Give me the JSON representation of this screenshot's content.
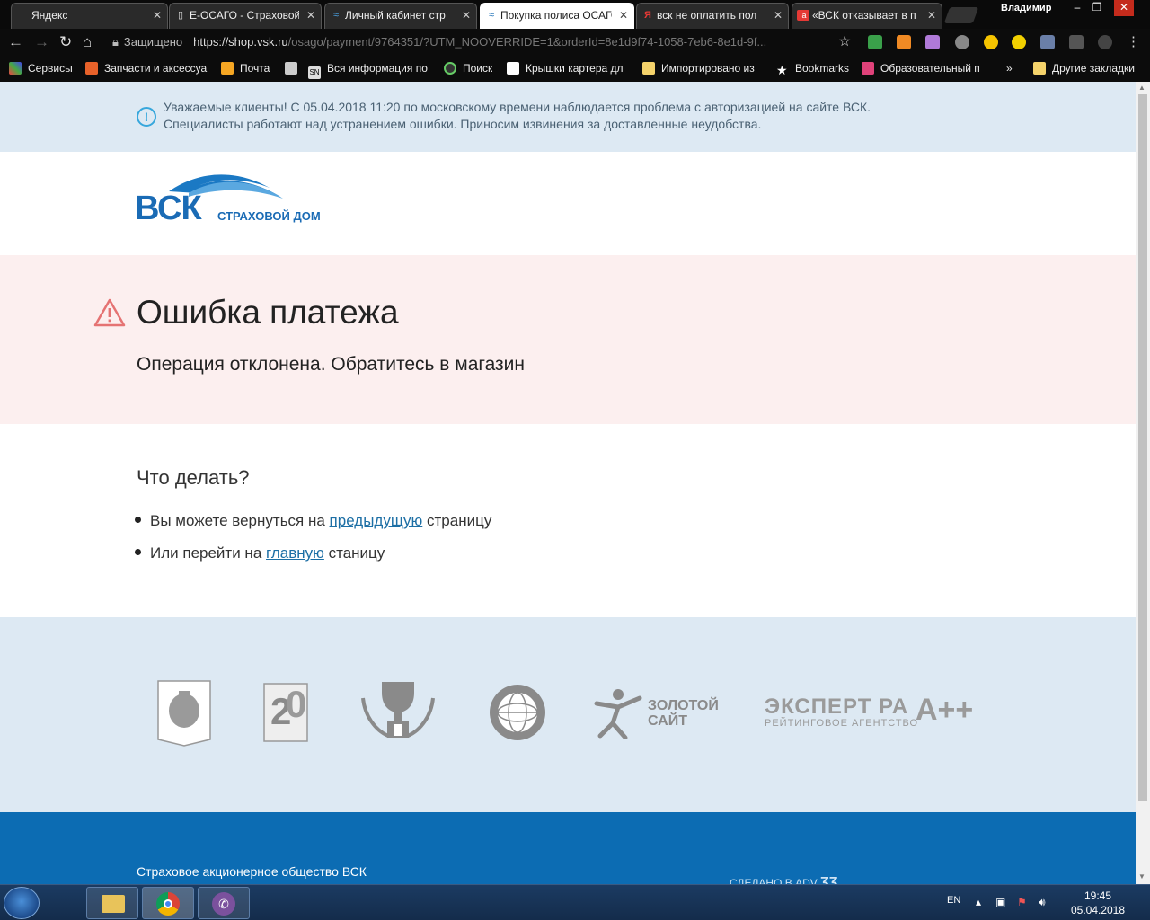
{
  "browser": {
    "tabs": [
      {
        "title": "Яндекс",
        "icon": "yandex-icon",
        "active": false
      },
      {
        "title": "Е-ОСАГО - Страховой",
        "icon": "page-icon",
        "active": false
      },
      {
        "title": "Личный кабинет стр",
        "icon": "vsk-icon",
        "active": false
      },
      {
        "title": "Покупка полиса ОСАГО",
        "icon": "vsk-icon",
        "active": true
      },
      {
        "title": "вск не оплатить пол",
        "icon": "yandex-icon",
        "active": false
      },
      {
        "title": "«ВСК отказывает в п",
        "icon": "la-icon",
        "active": false
      }
    ],
    "user_name": "Владимир",
    "security_label": "Защищено",
    "url_host": "https://shop.vsk.ru",
    "url_path": "/osago/payment/9764351/?UTM_NOOVERRIDE=1&orderId=8e1d9f74-1058-7eb6-8e1d-9f...",
    "bookmarks": [
      {
        "label": "Сервисы",
        "icon": "apps-icon"
      },
      {
        "label": "Запчасти и аксессуа",
        "icon": "parts-icon"
      },
      {
        "label": "Почта",
        "icon": "mail-icon"
      },
      {
        "label": "",
        "icon": "computer-icon"
      },
      {
        "label": "Вся информация по",
        "icon": "sn-icon"
      },
      {
        "label": "Поиск",
        "icon": "search-circle-icon"
      },
      {
        "label": "Крышки картера дл",
        "icon": "parts-icon"
      },
      {
        "label": "Импортировано из",
        "icon": "folder-icon"
      },
      {
        "label": "Bookmarks",
        "icon": "star-icon"
      },
      {
        "label": "Образовательный п",
        "icon": "edu-icon"
      }
    ],
    "bookmarks_overflow": "»",
    "other_bookmarks": "Другие закладки"
  },
  "page": {
    "notice_line1": "Уважаемые клиенты! С 05.04.2018 11:20 по московскому времени наблюдается проблема с авторизацией на сайте ВСК.",
    "notice_line2": "Специалисты работают над устранением ошибки. Приносим извинения за доставленные неудобства.",
    "logo_main": "ВСК",
    "logo_sub": "СТРАХОВОЙ ДОМ",
    "error_title": "Ошибка платежа",
    "error_message": "Операция отклонена. Обратитесь в магазин",
    "what_to_do": "Что делать?",
    "option1_before": "Вы можете вернуться на ",
    "option1_link": "предыдущую",
    "option1_after": " страницу",
    "option2_before": "Или перейти на ",
    "option2_link": "главную",
    "option2_after": " станицу",
    "badge_zoloto_line1": "ЗОЛОТОЙ",
    "badge_zoloto_line2": "САЙТ",
    "badge_expert_line1": "ЭКСПЕРТ РА",
    "badge_expert_line2": "РЕЙТИНГОВОЕ АГЕНТСТВО",
    "badge_rating": "A++",
    "footer_company": "Страховое акционерное общество ВСК",
    "footer_made": "СДЕЛАНО В ADV"
  },
  "taskbar": {
    "lang": "EN",
    "time": "19:45",
    "date": "05.04.2018"
  },
  "colors": {
    "notice_bg": "#dde9f3",
    "error_bg": "#fcefef",
    "brand_blue": "#0c6cb3",
    "link": "#1d6fa5",
    "warning_red": "#e57373"
  }
}
